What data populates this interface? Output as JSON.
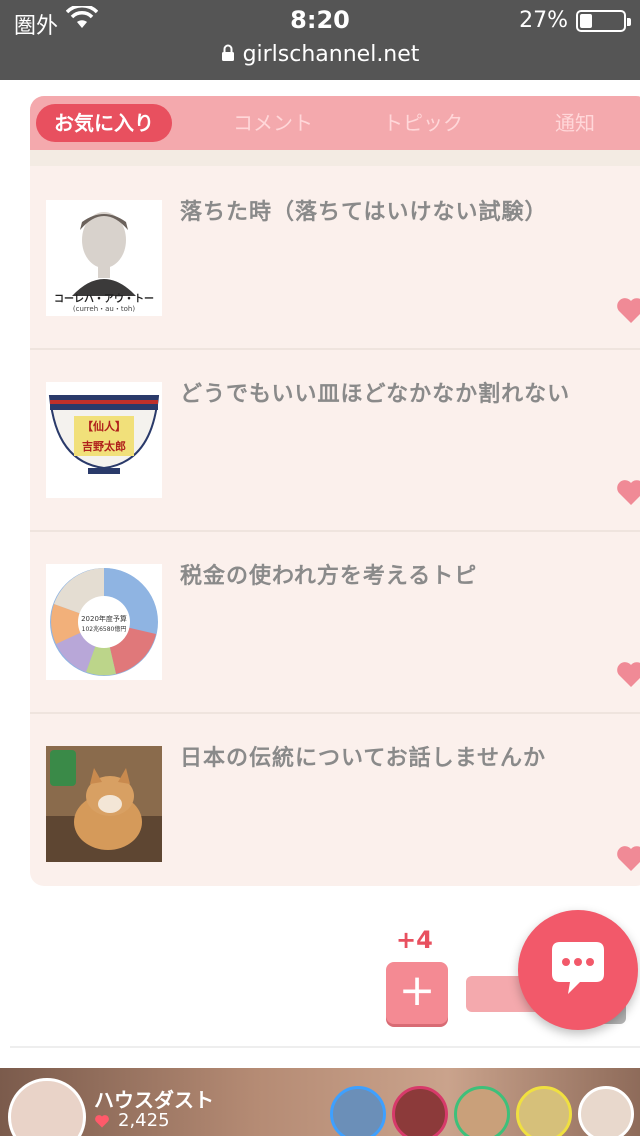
{
  "status_bar": {
    "carrier": "圏外",
    "time": "8:20",
    "battery": "27%",
    "url": "girlschannel.net"
  },
  "tabs": [
    {
      "label": "お気に入り",
      "active": true
    },
    {
      "label": "コメント",
      "active": false
    },
    {
      "label": "トピック",
      "active": false
    },
    {
      "label": "通知",
      "active": false
    }
  ],
  "items": [
    {
      "title": "落ちた時（落ちてはいけない試験）",
      "thumb_caption": "コーレハ・アウ・トー",
      "thumb_sub": "(curreh・au・toh)"
    },
    {
      "title": "どうでもいい皿ほどなかなか割れない",
      "thumb_caption": "【仙人】",
      "thumb_sub": "吉野太郎"
    },
    {
      "title": "税金の使われ方を考えるトピ",
      "thumb_caption": "2020年度予算",
      "thumb_sub": "102兆6580億円"
    },
    {
      "title": "日本の伝統についてお話しませんか",
      "thumb_caption": "",
      "thumb_sub": ""
    }
  ],
  "actions": {
    "plus_badge": "+4",
    "add_label": "+"
  },
  "banner": {
    "name": "ハウスダスト",
    "count": "2,425"
  },
  "colors": {
    "accent": "#e8505f",
    "tab_bar": "#f4a9ad",
    "panel_bg": "#fbf0ec",
    "status_bg": "#555555",
    "heart": "#f08a96",
    "chat_fab": "#f2596a"
  }
}
